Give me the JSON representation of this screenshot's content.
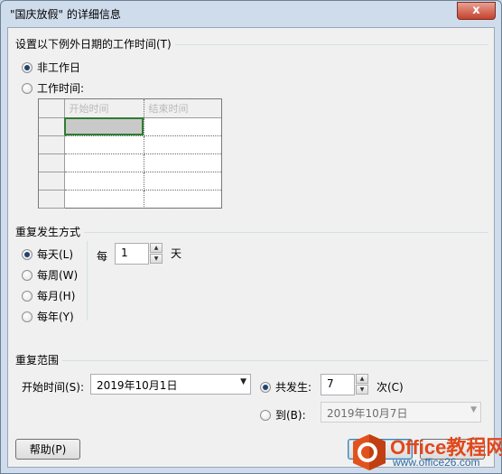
{
  "window": {
    "title": "\"国庆放假\" 的详细信息",
    "close_label": "x"
  },
  "exception_section": {
    "label": "设置以下例外日期的工作时间(T)",
    "options": [
      "非工作日",
      "工作时间:"
    ],
    "selected_option": "非工作日",
    "grid": {
      "columns": [
        "开始时间",
        "结束时间"
      ],
      "row_count": 5,
      "rows": []
    }
  },
  "recurrence_section": {
    "label": "重复发生方式",
    "options": [
      "每天(L)",
      "每周(W)",
      "每月(H)",
      "每年(Y)"
    ],
    "selected_option": "每天(L)",
    "every_prefix": "每",
    "interval_value": "1",
    "interval_unit": "天"
  },
  "range_section": {
    "label": "重复范围",
    "start_label": "开始时间(S):",
    "start_value": "2019年10月1日",
    "occurrences_label": "共发生:",
    "occurrences_value": "7",
    "occurrences_unit": "次(C)",
    "end_by_label": "到(B):",
    "end_by_value": "2019年10月7日",
    "selected_option": "共发生:"
  },
  "buttons": {
    "help_label": "帮助(P)"
  },
  "watermark": {
    "brand": "Office教程网",
    "url": "www.office26.com"
  }
}
